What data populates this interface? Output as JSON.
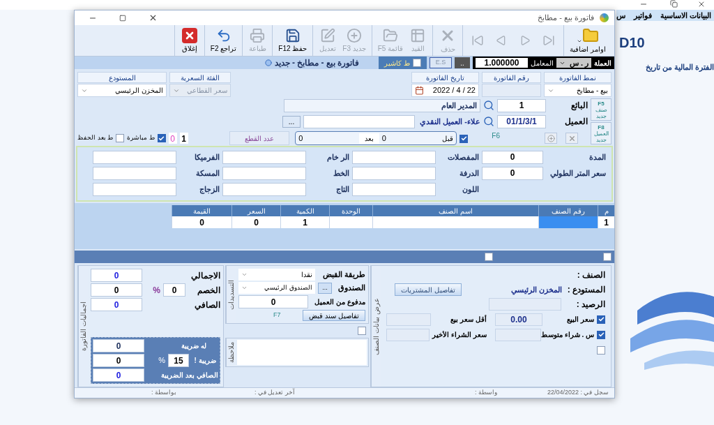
{
  "desktop": {
    "menu": [
      "البيانات الاساسية",
      "فواتير",
      "س"
    ],
    "heading": "D10",
    "subtitle": "الفترة المالية من تاريخ"
  },
  "window": {
    "title": "فاتورة بيع - مطابخ"
  },
  "toolbar": [
    [
      {
        "kind": "folder",
        "label": "اوامر اضافية",
        "disabled": false
      }
    ],
    [
      {
        "kind": "last",
        "disabled": true
      },
      {
        "kind": "next",
        "disabled": true
      },
      {
        "kind": "prev",
        "disabled": true
      },
      {
        "kind": "first",
        "disabled": true
      }
    ],
    [
      {
        "kind": "delete",
        "label": "حذف",
        "disabled": true
      }
    ],
    [
      {
        "kind": "post",
        "label": "القيد",
        "disabled": true
      },
      {
        "kind": "list",
        "label": "قائمة F5",
        "disabled": true
      }
    ],
    [
      {
        "kind": "new",
        "label": "جديد F3",
        "disabled": true
      },
      {
        "kind": "edit",
        "label": "تعديل",
        "disabled": true
      }
    ],
    [
      {
        "kind": "save",
        "label": "حفظ F12",
        "disabled": false
      }
    ],
    [
      {
        "kind": "print",
        "label": "طباعة",
        "disabled": true
      }
    ],
    [
      {
        "kind": "undo",
        "label": "تراجع F2",
        "disabled": false
      }
    ],
    [
      {
        "kind": "close",
        "label": "إغلاق",
        "disabled": false
      }
    ]
  ],
  "info_bar": {
    "currency_label": "العملة",
    "currency": "ر . س",
    "rate_label": "المعامل",
    "rate": "1.000000",
    "dots_button": "..",
    "es_button": "E.S",
    "cashier": {
      "label": "ط كاشير",
      "checked": false
    },
    "title": "فاتورة بيع - مطابخ - جديد"
  },
  "header": {
    "columns": [
      {
        "label": "نمط الفاتورة",
        "kind": "select",
        "value": "بيع - مطابخ",
        "disabled": false
      },
      {
        "label": "رقم الفاتورة",
        "kind": "readonly"
      },
      {
        "label": "تاريخ الفاتورة",
        "kind": "date",
        "value": "2022 / 4 / 22"
      },
      {
        "label": "الفئة السعرية",
        "kind": "select",
        "value": "سعر القطاعي",
        "disabled": true
      },
      {
        "label": "المستودع",
        "kind": "select",
        "value": "المخزن الرئيسي",
        "disabled": false
      }
    ]
  },
  "side_buttons": [
    {
      "key": "F5",
      "label": "صنف جديد"
    },
    {
      "key": "F8",
      "label": "العميل جديد"
    }
  ],
  "seller": {
    "label": "البائع",
    "code": "1",
    "name": "المدير العام"
  },
  "customer": {
    "label": "العميل",
    "code": "01/1/3/1",
    "name": "علاء- العميل النقدي",
    "more_button": "..."
  },
  "customer_key": "F6",
  "pieces": {
    "checked": true,
    "before_label": "قبل",
    "before": "0",
    "after_label": "بعد",
    "after": "0",
    "count_label": "عدد القطع"
  },
  "print_options": {
    "copies": "1",
    "printed": "0",
    "direct": {
      "label": "ط مباشرة",
      "checked": true
    },
    "after_save": {
      "label": "ط بعد الحفظ",
      "checked": false
    }
  },
  "kitchen_fields": [
    [
      {
        "label": "المدة",
        "value": "0"
      },
      {
        "label": "سعر المتر الطولي",
        "value": "0"
      }
    ],
    [
      {
        "label": "المفصلات"
      },
      {
        "label": "الدرفة"
      },
      {
        "label": "اللون"
      }
    ],
    [
      {
        "label": "الر خام"
      },
      {
        "label": "الخط"
      },
      {
        "label": "التاج"
      }
    ],
    [
      {
        "label": "الفرميكا"
      },
      {
        "label": "المسكة"
      },
      {
        "label": "الزجاج"
      }
    ]
  ],
  "items_table": {
    "columns": [
      "م",
      "رقم الصنف",
      "اسم الصنف",
      "الوحدة",
      "الكمية",
      "السعر",
      "القيمة"
    ],
    "rows": [
      {
        "cells": [
          "1",
          null,
          null,
          null,
          "1",
          "0",
          "0"
        ],
        "code_selected": true
      }
    ]
  },
  "band": {
    "checks": [
      {
        "checked": false
      },
      {
        "checked": false
      }
    ]
  },
  "item_details": {
    "tab": "عرض بيانات الصنف",
    "item_label": "الصنف :",
    "warehouse_label": "المستودع :",
    "warehouse": "المخزن الرئيسي",
    "balance_label": "الرصيد :",
    "purchases_button": "تفاصيل المشتريات",
    "prices": [
      {
        "checked": true,
        "label": "سعر البيع",
        "value": "0.00",
        "label2": "أقل سعر بيع"
      },
      {
        "checked": true,
        "label": "س . شراء متوسط",
        "label2": "سعر الشراء الأخير"
      },
      {
        "checked": false
      }
    ]
  },
  "payments": {
    "tab": "التسديدات",
    "method_label": "طريقة القبض",
    "method": "نقدا",
    "box_label": "الصندوق",
    "box": "الصندوق الرئيسي",
    "box_button": "...",
    "paid_label": "مدفوع من العميل",
    "paid": "0",
    "key": "F7",
    "receipt_button": "تفاصيل سند قبض"
  },
  "notes": {
    "checked": false,
    "label": "ملاحظة"
  },
  "totals": {
    "tab": "اجماليات الفاتورة",
    "total_label": "الاجمالي",
    "total": "0",
    "discount_label": "الخصم",
    "discount_percent": "0",
    "percent_sign": "%",
    "discount": "0",
    "net_label": "الصافي",
    "net": "0",
    "tax": {
      "taxable_label": "له ضريبة",
      "taxable": "0",
      "rate_label": "ضريبة !",
      "rate": "15",
      "percent_sign": "%",
      "amount": "0",
      "net_label": "الصافي بعد الضريبة",
      "net": "0"
    }
  },
  "status_bar": [
    {
      "label": "سجل في :",
      "value": "22/04/2022"
    },
    {
      "label": "واسطة :"
    },
    {
      "label": "آخر تعديل في :"
    },
    {
      "label": "بواسطة :"
    }
  ]
}
